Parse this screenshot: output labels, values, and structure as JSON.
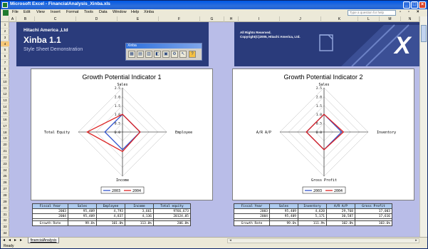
{
  "window": {
    "title": "Microsoft Excel - FinancialAnalysis_Xinba.xls"
  },
  "menu": {
    "items": [
      "File",
      "Edit",
      "View",
      "Insert",
      "Format",
      "Tools",
      "Data",
      "Window",
      "Help",
      "Xinba"
    ],
    "help_placeholder": "Type a question for help"
  },
  "columns": [
    "A",
    "B",
    "C",
    "D",
    "E",
    "F",
    "G",
    "H",
    "I",
    "J",
    "K",
    "L",
    "M",
    "N"
  ],
  "rows": [
    "1",
    "2",
    "3",
    "4",
    "5",
    "6",
    "7",
    "8",
    "9",
    "10",
    "11",
    "12",
    "13",
    "14",
    "15",
    "16",
    "17",
    "18",
    "19",
    "20",
    "21",
    "22",
    "23",
    "24",
    "25",
    "26",
    "27",
    "28",
    "29",
    "30",
    "31",
    "32",
    "33",
    "34"
  ],
  "banner": {
    "company": "Hitachi America ,Ltd",
    "product": "Xinba 1.1",
    "subtitle": "Style Sheet Demonstration",
    "rights_line1": "All Rights Reserved.",
    "rights_line2": "Copyright(C)2005, Hitachi America, Ltd."
  },
  "toolbar": {
    "title": "Xinba"
  },
  "charts": [
    {
      "title": "Growth Potential Indicator 1",
      "ticks": [
        "2.5",
        "2.0",
        "1.5",
        "1.0",
        "0.5",
        "0.0"
      ],
      "axis_labels": [
        "Sales",
        "Employee",
        "Income",
        "Total Equity"
      ],
      "legend": [
        "2003",
        "2004"
      ],
      "colors": [
        "#3355cc",
        "#dd2222"
      ]
    },
    {
      "title": "Growth Potential Indicator 2",
      "ticks": [
        "2.5",
        "2.0",
        "1.5",
        "1.0",
        "0.5",
        "0.0"
      ],
      "axis_labels": [
        "Sales",
        "Inventory",
        "Gross Profit",
        "A/R  A/P"
      ],
      "legend": [
        "2003",
        "2004"
      ],
      "colors": [
        "#3355cc",
        "#dd2222"
      ]
    }
  ],
  "chart_data": [
    {
      "type": "radar",
      "title": "Growth Potential Indicator 1",
      "axes": [
        "Sales",
        "Employee",
        "Income",
        "Total Equity"
      ],
      "range": [
        0,
        2.5
      ],
      "series": [
        {
          "name": "2003",
          "values": [
            1.0,
            1.0,
            1.0,
            1.0
          ]
        },
        {
          "name": "2004",
          "values": [
            1.0,
            1.0,
            1.1,
            2.0
          ]
        }
      ]
    },
    {
      "type": "radar",
      "title": "Growth Potential Indicator 2",
      "axes": [
        "Sales",
        "Inventory",
        "Gross Profit",
        "A/R  A/P"
      ],
      "range": [
        0,
        2.5
      ],
      "series": [
        {
          "name": "2003",
          "values": [
            1.0,
            1.0,
            1.0,
            1.0
          ]
        },
        {
          "name": "2004",
          "values": [
            1.0,
            1.1,
            1.0,
            1.0
          ]
        }
      ]
    }
  ],
  "tables": [
    {
      "headers": [
        "Fiscal Year",
        "Sales",
        "Employee",
        "Income",
        "Total equity"
      ],
      "rows": [
        [
          "2003",
          "95,409",
          "4,793",
          "3,661",
          "9766,673"
        ],
        [
          "2004",
          "95,409",
          "4,837",
          "4,136",
          "20124,05"
        ]
      ],
      "growth_label": "Growth Rate",
      "growth": [
        "99.6%",
        "101.0%",
        "113.0%",
        "206.0%"
      ]
    },
    {
      "headers": [
        "Fiscal Year",
        "Sales",
        "Inventory",
        "A/R A/P",
        "Gross Profit"
      ],
      "rows": [
        [
          "2003",
          "95,409",
          "4,620",
          "29,768",
          "17,003"
        ],
        [
          "2004",
          "95,409",
          "5,171",
          "30,587",
          "17,616"
        ]
      ],
      "growth_label": "Growth Rate",
      "growth": [
        "99.6%",
        "111.9%",
        "102.8%",
        "103.6%"
      ]
    }
  ],
  "sheet_tab": {
    "label": "financialAnalysis"
  },
  "status": {
    "text": "Ready"
  }
}
